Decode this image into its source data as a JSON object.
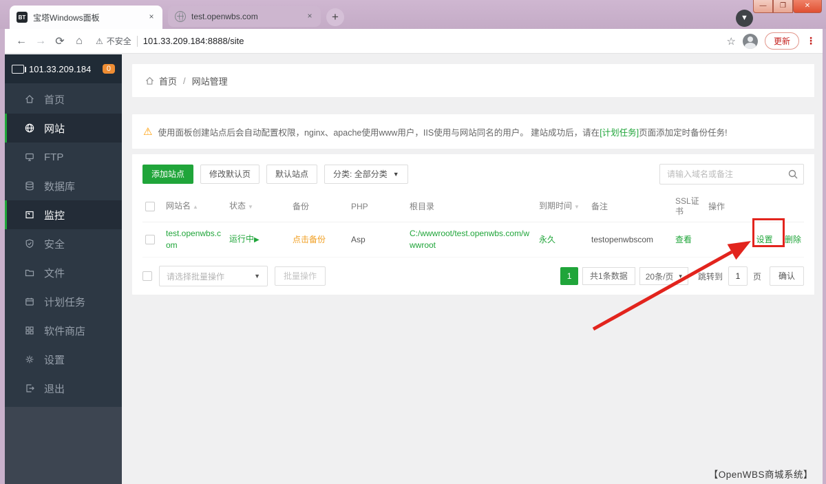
{
  "browser": {
    "tabs": [
      {
        "title": "宝塔Windows面板",
        "favicon_text": "BT"
      },
      {
        "title": "test.openwbs.com"
      }
    ],
    "close_tab": "×",
    "new_tab": "+",
    "security_label": "不安全",
    "url": "101.33.209.184:8888/site",
    "update_button": "更新",
    "window": {
      "minimize": "—",
      "maximize": "❐",
      "close": "✕"
    }
  },
  "icons": {
    "back": "←",
    "forward": "→",
    "refresh": "⟳",
    "home": "⌂",
    "warning_triangle": "⚠",
    "star": "☆",
    "more_vertical": "⋮",
    "download_circle": "▼",
    "chevron_down": "▼",
    "chevron_down_small": "▾",
    "sort_asc": "▲",
    "sort_desc": "▼",
    "play": "▶",
    "notice_warning": "⚠"
  },
  "colors": {
    "accent_green": "#20a53a",
    "badge_orange": "#ef8d33",
    "backup_orange": "#f1a024",
    "annotation_red": "#e2241d",
    "sidebar_dark": "#2d3844",
    "titlebar_lavender": "#c9b1cb"
  },
  "sidebar": {
    "server_ip": "101.33.209.184",
    "badge_count": "0",
    "items": [
      {
        "label": "首页"
      },
      {
        "label": "网站"
      },
      {
        "label": "FTP"
      },
      {
        "label": "数据库"
      },
      {
        "label": "监控"
      },
      {
        "label": "安全"
      },
      {
        "label": "文件"
      },
      {
        "label": "计划任务"
      },
      {
        "label": "软件商店"
      },
      {
        "label": "设置"
      },
      {
        "label": "退出"
      }
    ]
  },
  "breadcrumb": {
    "home": "首页",
    "separator": "/",
    "current": "网站管理"
  },
  "notice": {
    "text_before": "使用面板创建站点后会自动配置权限，nginx、apache使用www用户，IIS使用与网站同名的用户。 建站成功后，请在",
    "link": "[计划任务]",
    "text_after": "页面添加定时备份任务!"
  },
  "toolbar": {
    "add_site": "添加站点",
    "modify_default_page": "修改默认页",
    "default_site": "默认站点",
    "category_filter": "分类: 全部分类",
    "search_placeholder": "请输入域名或备注"
  },
  "table": {
    "headers": [
      "网站名",
      "状态",
      "备份",
      "PHP",
      "根目录",
      "到期时间",
      "备注",
      "SSL证书",
      "操作"
    ],
    "rows": [
      {
        "site_name": "test.openwbs.com",
        "status": "运行中",
        "backup": "点击备份",
        "php": "Asp",
        "root_path": "C:/wwwroot/test.openwbs.com/wwwroot",
        "expire": "永久",
        "remark": "testopenwbscom",
        "ssl": "查看",
        "action_settings": "设置",
        "action_delete": "删除"
      }
    ]
  },
  "batch": {
    "select_placeholder": "请选择批量操作",
    "button": "批量操作"
  },
  "pagination": {
    "page": "1",
    "total": "共1条数据",
    "per_page": "20条/页",
    "jump_label": "跳转到",
    "jump_value": "1",
    "page_unit": "页",
    "confirm": "确认"
  },
  "footer": {
    "brand": "【OpenWBS商城系统】"
  }
}
